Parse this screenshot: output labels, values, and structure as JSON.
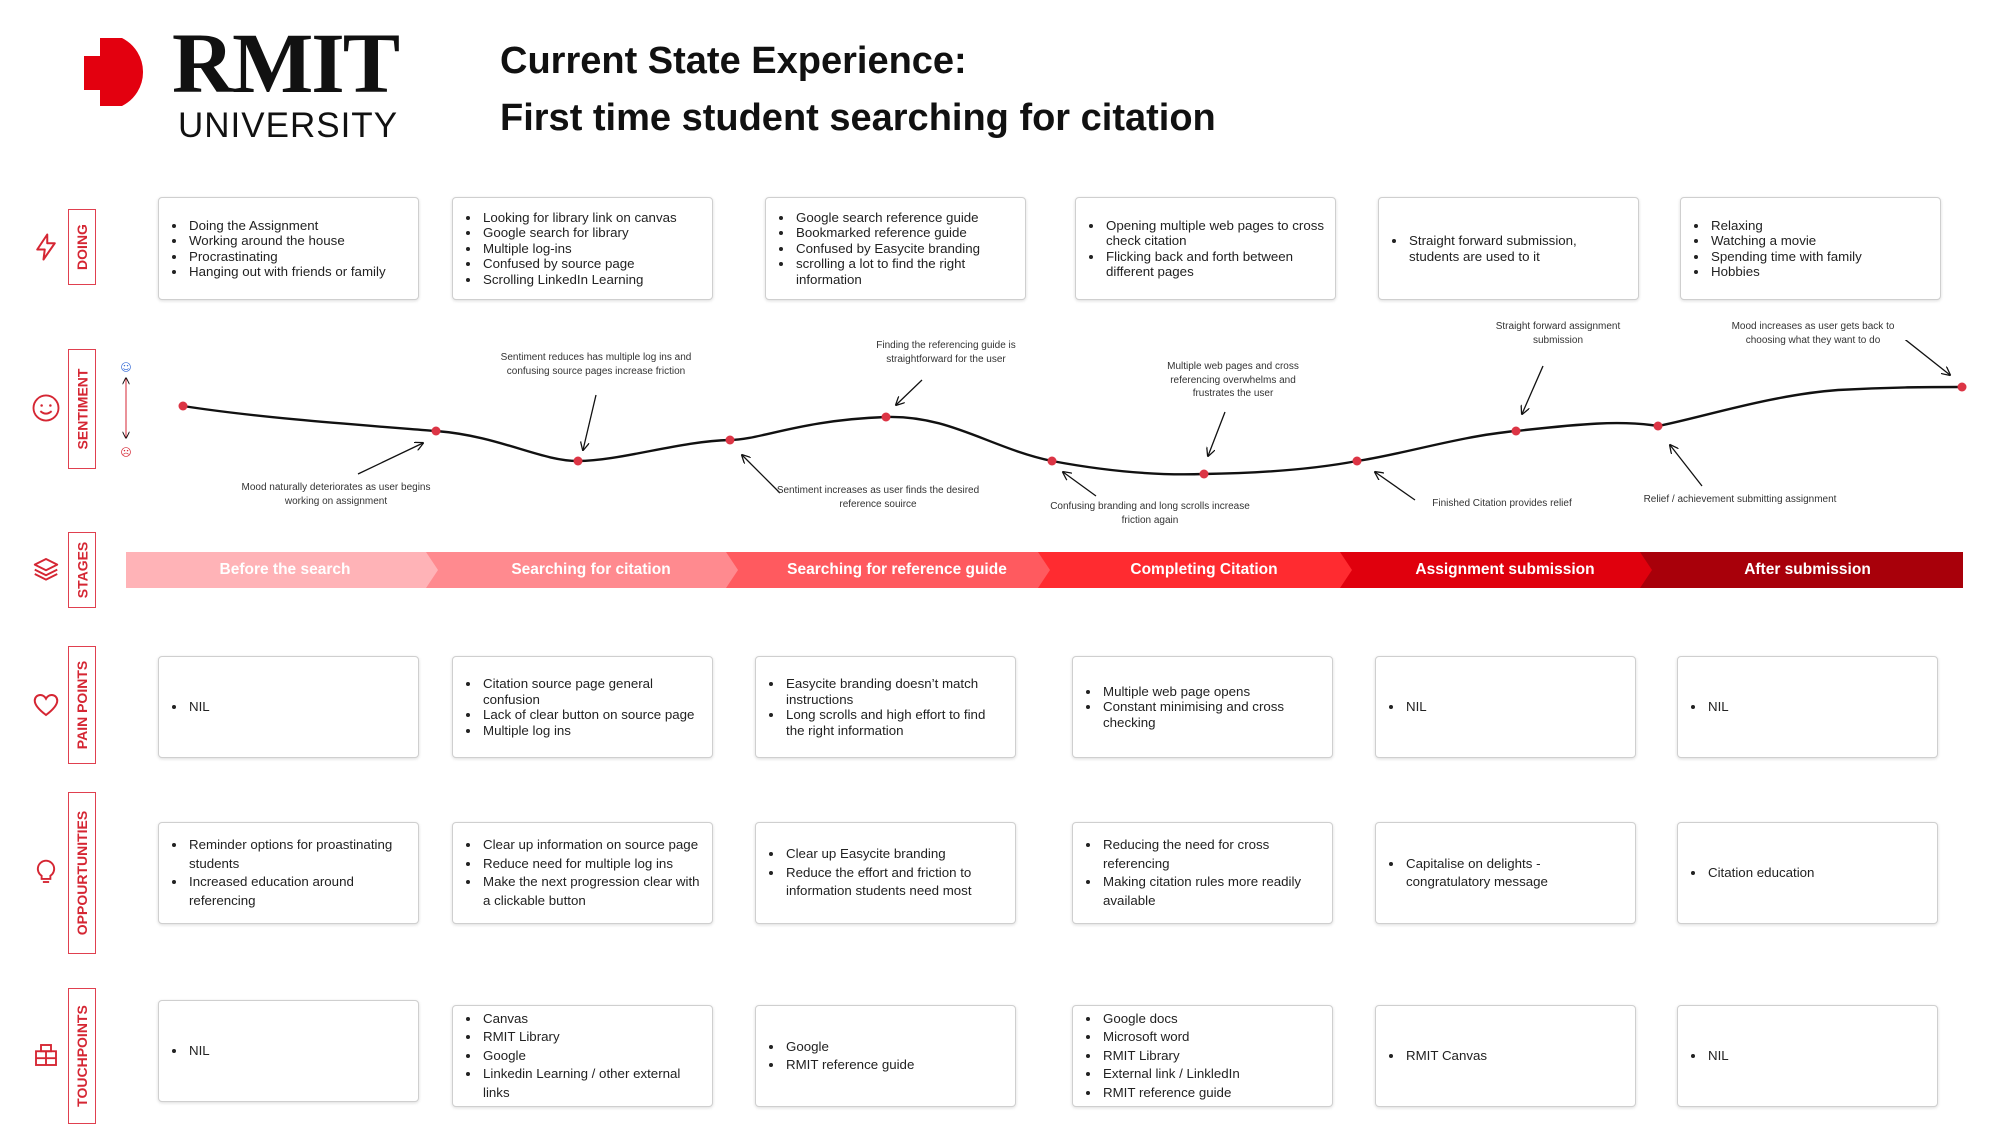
{
  "header": {
    "logo_word": "RMIT",
    "logo_sub": "UNIVERSITY",
    "title_line1": "Current State Experience:",
    "title_line2": "First time student searching for citation"
  },
  "rows": {
    "doing": "DOING",
    "sentiment": "SENTIMENT",
    "stages": "STAGES",
    "pain_points": "PAIN POINTS",
    "opportunities": "OPPOURTUNITIES",
    "touchpoints": "TOUCHPOINTS"
  },
  "doing": [
    [
      "Doing the Assignment",
      "Working around the house",
      "Procrastinating",
      "Hanging out with friends or family"
    ],
    [
      "Looking for library link on canvas",
      "Google search for library",
      "Multiple log-ins",
      "Confused by source page",
      "Scrolling LinkedIn Learning"
    ],
    [
      "Google search reference guide",
      "Bookmarked reference guide",
      "Confused by Easycite branding",
      "scrolling a lot to find the right information"
    ],
    [
      "Opening multiple web pages to cross check citation",
      "Flicking back and forth between different pages"
    ],
    [
      "Straight forward submission, students are used to it"
    ],
    [
      "Relaxing",
      "Watching a movie",
      "Spending time with family",
      "Hobbies"
    ]
  ],
  "sentiment": {
    "annotations": [
      "Mood naturally deteriorates as user begins working on assignment",
      "Sentiment reduces has multiple log ins and confusing source pages increase friction",
      "Sentiment increases as user finds the desired reference souirce",
      "Finding the referencing guide is straightforward for the user",
      "Confusing branding and long scrolls increase friction again",
      "Multiple web pages and cross referencing overwhelms and frustrates the user",
      "Finished Citation provides relief",
      "Straight forward assignment submission",
      "Relief / achievement submitting assignment",
      "Mood increases as user gets back to choosing what they want to do"
    ]
  },
  "stages": {
    "items": [
      {
        "label": "Before the search",
        "color": "#ffb3b7"
      },
      {
        "label": "Searching for citation",
        "color": "#ff8a8f"
      },
      {
        "label": "Searching for reference guide",
        "color": "#ff5a5f"
      },
      {
        "label": "Completing Citation",
        "color": "#ff2b30"
      },
      {
        "label": "Assignment submission",
        "color": "#e0000d"
      },
      {
        "label": "After submission",
        "color": "#a8000a"
      }
    ]
  },
  "pain_points": [
    [
      "NIL"
    ],
    [
      "Citation source page general confusion",
      "Lack of clear button on source page",
      "Multiple log ins"
    ],
    [
      "Easycite branding doesn’t match instructions",
      "Long scrolls and high effort to find the right information"
    ],
    [
      "Multiple web page opens",
      "Constant minimising and cross checking"
    ],
    [
      "NIL"
    ],
    [
      "NIL"
    ]
  ],
  "opportunities": [
    [
      "Reminder options for proastinating students",
      "Increased education around referencing"
    ],
    [
      "Clear up information on source page",
      "Reduce need for multiple log ins",
      "Make the next progression clear with a clickable button"
    ],
    [
      "Clear up Easycite branding",
      "Reduce the effort and friction to information students need most"
    ],
    [
      "Reducing the need for cross referencing",
      "Making citation rules more readily available"
    ],
    [
      "Capitalise on delights - congratulatory message"
    ],
    [
      "Citation education"
    ]
  ],
  "touchpoints": [
    [
      "NIL"
    ],
    [
      "Canvas",
      "RMIT Library",
      "Google",
      "Linkedin Learning / other external links"
    ],
    [
      "Google",
      "RMIT reference guide"
    ],
    [
      "Google docs",
      "Microsoft word",
      "RMIT Library",
      "External link / LinkledIn",
      "RMIT reference guide"
    ],
    [
      "RMIT Canvas"
    ],
    [
      "NIL"
    ]
  ],
  "colors": {
    "accent": "#d52633",
    "curve": "#111111",
    "dot": "#dc3545"
  },
  "icons": [
    "lightning-icon",
    "smiley-icon",
    "layers-icon",
    "heart-icon",
    "lightbulb-icon",
    "building-icon"
  ]
}
